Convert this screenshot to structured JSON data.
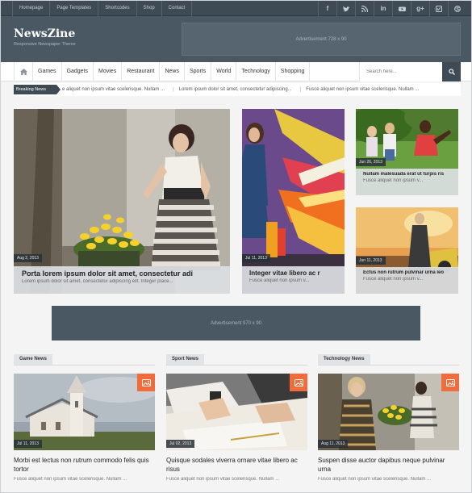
{
  "topbar": {
    "links": [
      "Homepage",
      "Page Templates",
      "Shortcodes",
      "Shop",
      "Contact"
    ],
    "social_icons": [
      "facebook-icon",
      "twitter-icon",
      "rss-icon",
      "linkedin-icon",
      "youtube-icon",
      "google-plus-icon",
      "vimeo-icon",
      "dribbble-icon"
    ]
  },
  "header": {
    "logo": "NewsZine",
    "tagline": "Responsive Newspaper Theme",
    "ad_text": "Advertisement 728 x 90"
  },
  "nav": {
    "home_icon": "home-icon",
    "items": [
      "Games",
      "Gadgets",
      "Movies",
      "Restaurant",
      "News",
      "Sports",
      "World",
      "Technology",
      "Shopping"
    ],
    "search_placeholder": "Search here...",
    "search_icon": "search-icon"
  },
  "breaking": {
    "label": "Breaking News",
    "items": [
      "e aliquet non ipsum vitae scelerisque. Nullam ...",
      "Lorem ipsum dolor sit amet, consectetur adipiscing...",
      "Fusce aliquet non ipsum vitae scelerisque. Nullam ..."
    ]
  },
  "featured": {
    "main": {
      "date": "Aug 2, 2013",
      "title": "Porta lorem ipsum dolor sit amet, consectetur adi",
      "excerpt": "Lorem ipsum dolor sit amet, consectetur adipiscing elit. Integer place..."
    },
    "middle": {
      "date": "Jul 11, 2013",
      "title": "Integer vitae libero ac r",
      "excerpt": "Fusce aliquet non ipsum v..."
    },
    "right_top": {
      "date": "Jun 26, 2013",
      "title": "Nullam malesuada erat ut turpis ris",
      "excerpt": "Fusce aliquet non ipsum v..."
    },
    "right_bottom": {
      "date": "Jun 11, 2013",
      "title": "Ectus non rutrum pulvinar urna leo",
      "excerpt": "Fusce aliquet non ipsum v..."
    }
  },
  "mid_ad": {
    "text": "Advertisement 970 x 90"
  },
  "sections": [
    {
      "label": "Game News",
      "date": "Jul 11, 2013",
      "title": "Morbi est lectus non rutrum commodo felis quis tortor",
      "excerpt": "Fusce aliquet non ipsum vitae scelerisque. Nullam ..."
    },
    {
      "label": "Sport News",
      "date": "Jul 02, 2013",
      "title": "Quisque sodales viverra ornare vitae libero ac risus",
      "excerpt": "Fusce aliquet non ipsum vitae scelerisque. Nullam ..."
    },
    {
      "label": "Technology News",
      "date": "Aug 11, 2013",
      "title": "Suspen disse auctor dapibus neque pulvinar urna",
      "excerpt": "Fusce aliquet non ipsum vitae scelerisque. Nullam ..."
    }
  ],
  "colors": {
    "dark": "#3e4a54",
    "header": "#4a5863",
    "accent": "#f26b3a"
  }
}
